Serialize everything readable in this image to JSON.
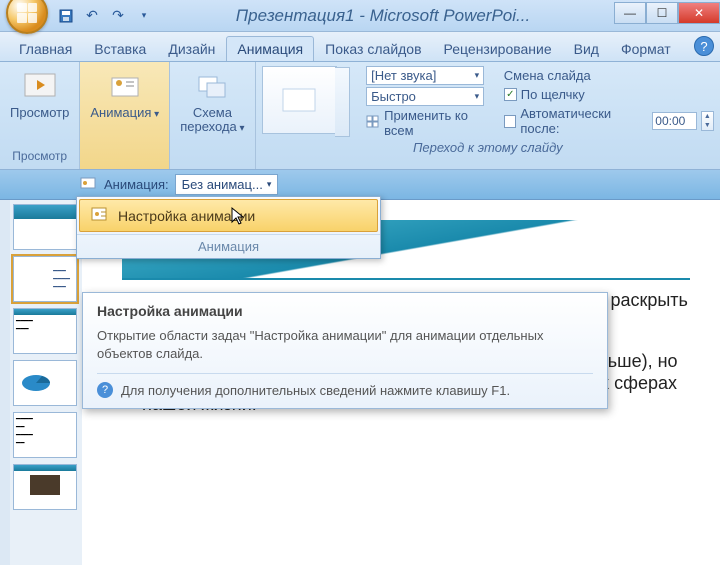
{
  "titlebar": {
    "title": "Презентация1 - Microsoft PowerPoi..."
  },
  "tabs": {
    "items": [
      "Главная",
      "Вставка",
      "Дизайн",
      "Анимация",
      "Показ слайдов",
      "Рецензирование",
      "Вид",
      "Формат"
    ],
    "active_index": 3
  },
  "ribbon": {
    "preview": {
      "label": "Просмотр",
      "group": "Просмотр"
    },
    "anim": {
      "label": "Анимация",
      "group": ""
    },
    "scheme": {
      "label": "Схема\nперехода"
    },
    "sound_label": "[Нет звука]",
    "speed_label": "Быстро",
    "applyall": "Применить ко всем",
    "changeslide_title": "Смена слайда",
    "onclick": "По щелчку",
    "auto_after": "Автоматически после:",
    "time": "00:00",
    "transition_group": "Переход к этому слайду"
  },
  "subbar": {
    "anim_label": "Анимация:",
    "anim_value": "Без анимац..."
  },
  "dropdown": {
    "item": "Настройка анимации",
    "section": "Анимация"
  },
  "tooltip": {
    "title": "Настройка анимации",
    "body": "Открытие области задач \"Настройка анимации\" для анимации отдельных объектов слайда.",
    "help": "Для получения дополнительных сведений нажмите клавишу F1."
  },
  "slide": {
    "p1": "информации, помогающее докладчику более детально раскрыть суть его работы.",
    "p2": "Сейчас их используют не только бизнесмены (как раньше), но и простые студенты, школьники, да в общем, во многих сферах нашей жизни!"
  }
}
